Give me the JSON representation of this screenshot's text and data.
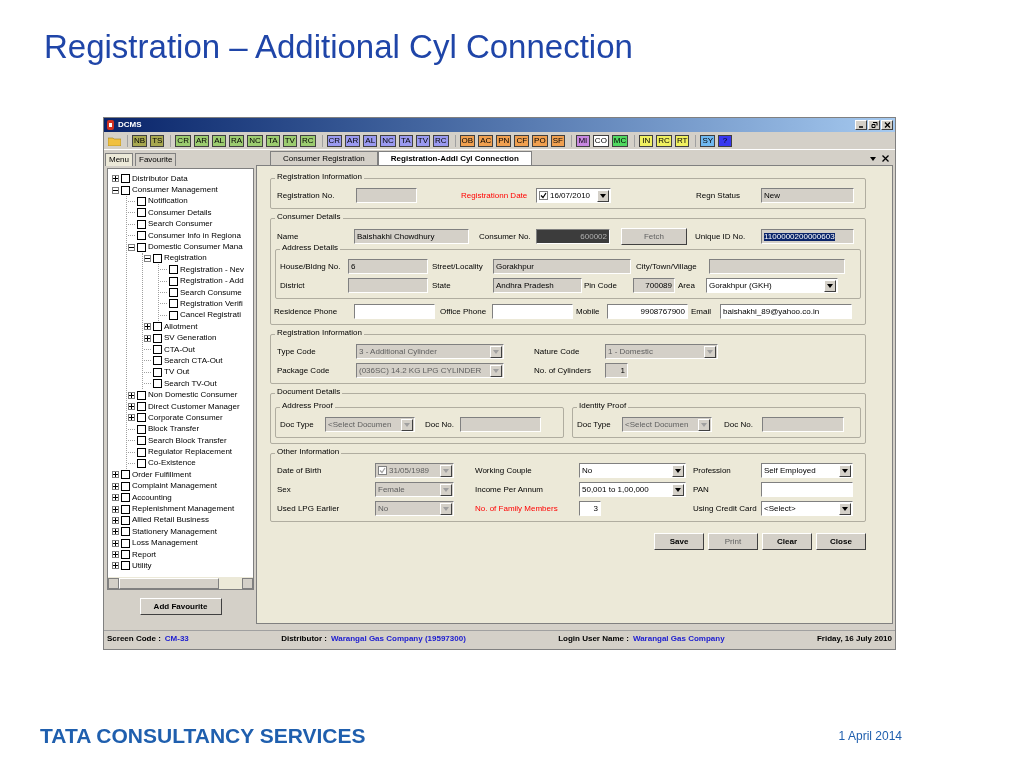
{
  "slide": {
    "title": "Registration – Additional Cyl Connection",
    "footer_logo": "TATA CONSULTANCY SERVICES",
    "date": "1 April 2014"
  },
  "window": {
    "title": "DCMS"
  },
  "toolbar": [
    [
      {
        "label": "NB",
        "color": "#a8a850"
      },
      {
        "label": "TS",
        "color": "#a8a850"
      }
    ],
    [
      {
        "label": "CR",
        "color": "#9ccc70"
      },
      {
        "label": "AR",
        "color": "#9ccc70"
      },
      {
        "label": "AL",
        "color": "#9ccc70"
      },
      {
        "label": "RA",
        "color": "#9ccc70"
      },
      {
        "label": "NC",
        "color": "#9ccc70"
      },
      {
        "label": "TA",
        "color": "#9ccc70"
      },
      {
        "label": "TV",
        "color": "#9ccc70"
      },
      {
        "label": "RC",
        "color": "#9ccc70"
      }
    ],
    [
      {
        "label": "CR",
        "color": "#9a9af0"
      },
      {
        "label": "AR",
        "color": "#9a9af0"
      },
      {
        "label": "AL",
        "color": "#9a9af0"
      },
      {
        "label": "NC",
        "color": "#9a9af0"
      },
      {
        "label": "TA",
        "color": "#9a9af0"
      },
      {
        "label": "TV",
        "color": "#9a9af0"
      },
      {
        "label": "RC",
        "color": "#9a9af0"
      }
    ],
    [
      {
        "label": "OB",
        "color": "#f0a050"
      },
      {
        "label": "AC",
        "color": "#f0a050"
      },
      {
        "label": "PN",
        "color": "#f0a050"
      },
      {
        "label": "CF",
        "color": "#f0a050"
      },
      {
        "label": "PO",
        "color": "#f0a050"
      },
      {
        "label": "SF",
        "color": "#f0a050"
      }
    ],
    [
      {
        "label": "MI",
        "color": "#c888e0"
      },
      {
        "label": "CO",
        "color": "#ffffff"
      },
      {
        "label": "MC",
        "color": "#50d860"
      }
    ],
    [
      {
        "label": "IN",
        "color": "#f0f060"
      },
      {
        "label": "RC",
        "color": "#f0f060"
      },
      {
        "label": "RT",
        "color": "#f0f060"
      }
    ],
    [
      {
        "label": "SY",
        "color": "#70b8f0"
      },
      {
        "label": "?",
        "color": "#3838f0"
      }
    ]
  ],
  "left_tabs": [
    {
      "label": "Menu",
      "selected": true
    },
    {
      "label": "Favourite",
      "selected": false
    }
  ],
  "tree": [
    {
      "label": "Distributor Data",
      "checked": false,
      "expanded": false
    },
    {
      "label": "Consumer Management",
      "checked": false,
      "expanded": true,
      "children": [
        {
          "label": "Notification",
          "checked": false
        },
        {
          "label": "Consumer Details",
          "checked": false
        },
        {
          "label": "Search Consumer",
          "checked": false
        },
        {
          "label": "Consumer Info in Regiona",
          "checked": false
        },
        {
          "label": "Domestic Consumer Mana",
          "checked": false,
          "expanded": true,
          "children": [
            {
              "label": "Registration",
              "checked": false,
              "expanded": true,
              "children": [
                {
                  "label": "Registration - Nev",
                  "checked": false
                },
                {
                  "label": "Registration - Add",
                  "checked": false
                },
                {
                  "label": "Search Consume",
                  "checked": false
                },
                {
                  "label": "Registration Verifi",
                  "checked": false
                },
                {
                  "label": "Cancel Registrati",
                  "checked": false
                }
              ]
            },
            {
              "label": "Allotment",
              "checked": false,
              "expanded": false
            },
            {
              "label": "SV Generation",
              "checked": false,
              "expanded": false
            },
            {
              "label": "CTA-Out",
              "checked": false
            },
            {
              "label": "Search CTA-Out",
              "checked": false
            },
            {
              "label": "TV Out",
              "checked": false
            },
            {
              "label": "Search TV-Out",
              "checked": false
            }
          ]
        },
        {
          "label": "Non Domestic Consumer",
          "checked": false,
          "expanded": false
        },
        {
          "label": "Direct Customer Manager",
          "checked": false,
          "expanded": false
        },
        {
          "label": "Corporate Consumer",
          "checked": false,
          "expanded": false
        },
        {
          "label": "Block Transfer",
          "checked": false
        },
        {
          "label": "Search Block Transfer",
          "checked": false
        },
        {
          "label": "Regulator Replacement",
          "checked": false
        },
        {
          "label": "Co-Existence",
          "checked": false
        }
      ]
    },
    {
      "label": "Order Fulfillment",
      "checked": false,
      "expanded": false
    },
    {
      "label": "Complaint Management",
      "checked": false,
      "expanded": false
    },
    {
      "label": "Accounting",
      "checked": false,
      "expanded": false
    },
    {
      "label": "Replenishment Management",
      "checked": false,
      "expanded": false
    },
    {
      "label": "Allied Retail Business",
      "checked": false,
      "expanded": false
    },
    {
      "label": "Stationery Management",
      "checked": false,
      "expanded": false
    },
    {
      "label": "Loss Management",
      "checked": false,
      "expanded": false
    },
    {
      "label": "Report",
      "checked": false,
      "expanded": false
    },
    {
      "label": "Utility",
      "checked": false,
      "expanded": false
    }
  ],
  "add_favourite": "Add Favourite",
  "doc_tabs": [
    {
      "label": "Consumer Registration",
      "selected": false
    },
    {
      "label": "Registration-Addl Cyl Connection",
      "selected": true
    }
  ],
  "sections": [
    {
      "title": "Registration Information",
      "rows": [
        [
          {
            "label": "Registration No.",
            "kind": "text",
            "disabled": true,
            "required": false
          },
          {
            "label": "Registrationn Date",
            "kind": "date",
            "value": "16/07/2010",
            "checked": true,
            "disabled": false,
            "required": true
          },
          {
            "label": "Regn Status",
            "kind": "text",
            "value": "New",
            "disabled": true,
            "required": false
          }
        ]
      ]
    },
    {
      "title": "Consumer Details",
      "rows": [
        [
          {
            "label": "Name",
            "kind": "text",
            "value": "Baishakhi Chowdhury",
            "disabled": true,
            "required": false
          },
          {
            "label": "Consumer No.",
            "kind": "shaded",
            "value": "600002",
            "disabled": true,
            "required": false
          },
          {
            "kind": "button",
            "value": "Fetch",
            "disabled": true
          },
          {
            "label": "Unique ID No.",
            "kind": "text",
            "value": "1100000200000603",
            "disabled": true,
            "required": false,
            "selected": true
          }
        ]
      ],
      "groups": [
        {
          "title": "Address Details",
          "rows": [
            [
              {
                "label": "House/Bldng No.",
                "kind": "text",
                "value": "6",
                "disabled": true,
                "required": false
              },
              {
                "label": "Street/Locality",
                "kind": "text",
                "value": "Gorakhpur",
                "disabled": true,
                "required": false
              },
              {
                "label": "City/Town/Village",
                "kind": "text",
                "disabled": true,
                "required": false
              }
            ],
            [
              {
                "label": "District",
                "kind": "text",
                "disabled": true,
                "required": false
              },
              {
                "label": "State",
                "kind": "text",
                "value": "Andhra Pradesh",
                "disabled": true,
                "required": false
              },
              {
                "label": "Pin Code",
                "kind": "text",
                "value": "700089",
                "disabled": true,
                "required": false
              },
              {
                "label": "Area",
                "kind": "select",
                "value": "Gorakhpur (GKH)",
                "disabled": false,
                "required": false
              }
            ]
          ]
        }
      ],
      "rows_after": [
        [
          {
            "label": "Residence Phone",
            "kind": "text",
            "disabled": false,
            "required": false
          },
          {
            "label": "Office Phone",
            "kind": "text",
            "disabled": false,
            "required": false
          },
          {
            "label": "Mobile",
            "kind": "text",
            "value": "9908767900",
            "disabled": false,
            "required": false
          },
          {
            "label": "Email",
            "kind": "text",
            "value": "baishakhi_89@yahoo.co.in",
            "disabled": false,
            "required": false
          }
        ]
      ]
    },
    {
      "title": "Registration Information",
      "rows": [
        [
          {
            "label": "Type Code",
            "kind": "select",
            "value": "3 - Additional Cylinder",
            "disabled": true,
            "required": false
          },
          {
            "label": "Nature Code",
            "kind": "select",
            "value": "1 - Domestic",
            "disabled": true,
            "required": false
          }
        ],
        [
          {
            "label": "Package Code",
            "kind": "select",
            "value": "(036SC) 14.2 KG LPG CYLINDER",
            "disabled": true,
            "required": false
          },
          {
            "label": "No. of Cylinders",
            "kind": "text",
            "value": "1",
            "disabled": true,
            "required": false
          }
        ]
      ]
    },
    {
      "title": "Document Details",
      "groups": [
        {
          "title": "Address Proof",
          "rows": [
            [
              {
                "label": "Doc Type",
                "kind": "select",
                "value": "<Select Documen",
                "disabled": true,
                "required": false
              },
              {
                "label": "Doc No.",
                "kind": "text",
                "disabled": true,
                "required": false
              }
            ]
          ]
        },
        {
          "title": "Identity Proof",
          "rows": [
            [
              {
                "label": "Doc Type",
                "kind": "select",
                "value": "<Select Documen",
                "disabled": true,
                "required": false
              },
              {
                "label": "Doc No.",
                "kind": "text",
                "disabled": true,
                "required": false
              }
            ]
          ]
        }
      ]
    },
    {
      "title": "Other Information",
      "rows": [
        [
          {
            "label": "Date of Birth",
            "kind": "date",
            "value": "31/05/1989",
            "checked": true,
            "disabled": true,
            "required": false
          },
          {
            "label": "Working Couple",
            "kind": "select",
            "value": "No",
            "disabled": false,
            "required": false
          },
          {
            "label": "Profession",
            "kind": "select",
            "value": "Self Employed",
            "disabled": false,
            "required": false
          }
        ],
        [
          {
            "label": "Sex",
            "kind": "select",
            "value": "Female",
            "disabled": true,
            "required": false
          },
          {
            "label": "Income Per Annum",
            "kind": "select",
            "value": "50,001 to 1,00,000",
            "disabled": false,
            "required": false
          },
          {
            "label": "PAN",
            "kind": "text",
            "disabled": false,
            "required": false
          }
        ],
        [
          {
            "label": "Used LPG Earlier",
            "kind": "select",
            "value": "No",
            "disabled": true,
            "required": false
          },
          {
            "label": "No. of Family Members",
            "kind": "text",
            "value": "3",
            "disabled": false,
            "required": true
          },
          {
            "label": "Using Credit Card",
            "kind": "select",
            "value": "<Select>",
            "disabled": false,
            "required": false
          }
        ]
      ]
    }
  ],
  "buttons": [
    {
      "label": "Save",
      "disabled": false
    },
    {
      "label": "Print",
      "disabled": true
    },
    {
      "label": "Clear",
      "disabled": false
    },
    {
      "label": "Close",
      "disabled": false
    }
  ],
  "status_bar": [
    {
      "label": "Screen Code :",
      "value": "CM-33"
    },
    {
      "label": "Distributor :",
      "value": "Warangal Gas Company (19597300)"
    },
    {
      "label": "Login User Name :",
      "value": "Warangal Gas Company"
    },
    {
      "label": "Friday, 16 July 2010"
    }
  ]
}
